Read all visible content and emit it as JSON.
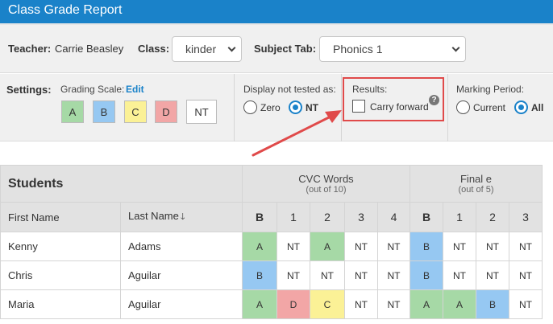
{
  "title": "Class Grade Report",
  "filters": {
    "teacher_label": "Teacher:",
    "teacher_value": "Carrie Beasley",
    "class_label": "Class:",
    "class_value": "kinder",
    "subject_label": "Subject Tab:",
    "subject_value": "Phonics 1"
  },
  "settings": {
    "label": "Settings:",
    "grading_scale_label": "Grading Scale:",
    "edit_label": "Edit",
    "grades": [
      {
        "label": "A",
        "color": "#a6d9a6"
      },
      {
        "label": "B",
        "color": "#96c8f2"
      },
      {
        "label": "C",
        "color": "#fbf196"
      },
      {
        "label": "D",
        "color": "#f2a6a6"
      },
      {
        "label": "NT",
        "color": "#ffffff"
      }
    ],
    "not_tested": {
      "label": "Display not tested as:",
      "options": [
        "Zero",
        "NT"
      ],
      "selected": "NT"
    },
    "results": {
      "label": "Results:",
      "carry_forward_label": "Carry forward",
      "carry_forward_checked": false,
      "help_glyph": "?"
    },
    "marking_period": {
      "label": "Marking Period:",
      "options": [
        "Current",
        "All"
      ],
      "selected": "All"
    }
  },
  "table": {
    "students_label": "Students",
    "first_name_label": "First Name",
    "last_name_label": "Last Name",
    "sort_arrow": "🡓",
    "groups": [
      {
        "title": "CVC Words",
        "subtitle": "(out of 10)",
        "columns": [
          "B",
          "1",
          "2",
          "3",
          "4"
        ]
      },
      {
        "title": "Final e",
        "subtitle": "(out of 5)",
        "columns": [
          "B",
          "1",
          "2",
          "3"
        ]
      }
    ],
    "rows": [
      {
        "first": "Kenny",
        "last": "Adams",
        "cells": [
          "A",
          "NT",
          "A",
          "NT",
          "NT",
          "B",
          "NT",
          "NT",
          "NT"
        ]
      },
      {
        "first": "Chris",
        "last": "Aguilar",
        "cells": [
          "B",
          "NT",
          "NT",
          "NT",
          "NT",
          "B",
          "NT",
          "NT",
          "NT"
        ]
      },
      {
        "first": "Maria",
        "last": "Aguilar",
        "cells": [
          "A",
          "D",
          "C",
          "NT",
          "NT",
          "A",
          "A",
          "B",
          "NT"
        ]
      }
    ]
  },
  "colors": {
    "accent": "#1a82c9",
    "annotation": "#e04a4a",
    "A": "#a6d9a6",
    "B": "#96c8f2",
    "C": "#fbf196",
    "D": "#f2a6a6",
    "NT": "#ffffff"
  }
}
